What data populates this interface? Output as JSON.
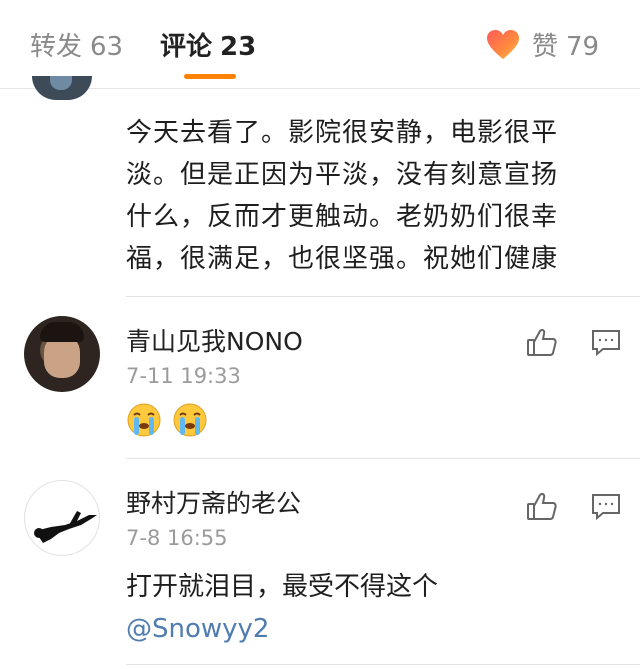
{
  "tabs": {
    "reposts": {
      "label": "转发",
      "count": "63"
    },
    "comments": {
      "label": "评论",
      "count": "23"
    },
    "likes": {
      "label": "赞",
      "count": "79"
    }
  },
  "comments": [
    {
      "text_lines": [
        "今天去看了。影院很安静，电影很平",
        "淡。但是正因为平淡，没有刻意宣扬",
        "什么，反而才更触动。老奶奶们很幸",
        "福，很满足，也很坚强。祝她们健康"
      ]
    },
    {
      "username": "青山见我NONO",
      "timestamp": "7-11 19:33",
      "emoji": [
        "crying-face",
        "crying-face"
      ]
    },
    {
      "username": "野村万斋的老公",
      "timestamp": "7-8 16:55",
      "text": "打开就泪目，最受不得这个",
      "mention": "@Snowyy2"
    }
  ],
  "colors": {
    "accent": "#ff8200",
    "mention": "#507daf",
    "muted_text": "#9b9b9b"
  }
}
